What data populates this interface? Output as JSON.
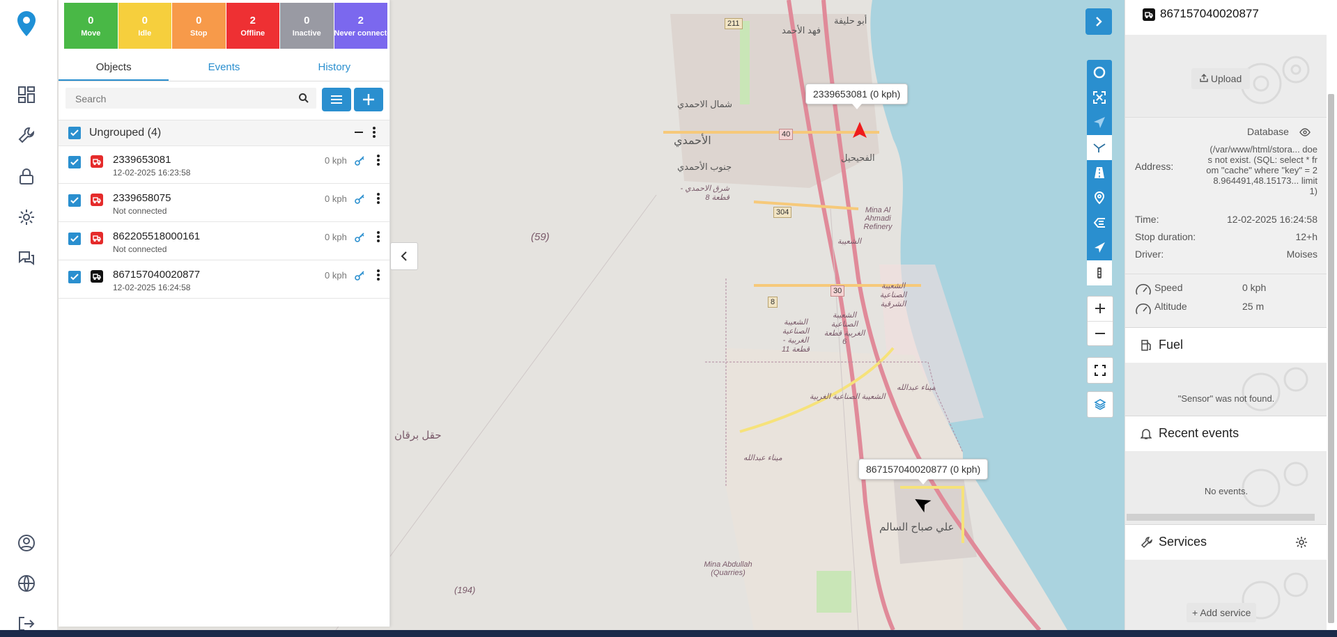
{
  "status_tiles": [
    {
      "count": "0",
      "label": "Move",
      "color": "#49b846"
    },
    {
      "count": "0",
      "label": "Idle",
      "color": "#f6cf3d"
    },
    {
      "count": "0",
      "label": "Stop",
      "color": "#f79a4a"
    },
    {
      "count": "2",
      "label": "Offline",
      "color": "#ee3033"
    },
    {
      "count": "0",
      "label": "Inactive",
      "color": "#999aa3"
    },
    {
      "count": "2",
      "label": "Never connected",
      "color": "#7b68ee"
    }
  ],
  "tabs": [
    "Objects",
    "Events",
    "History"
  ],
  "search": {
    "placeholder": "Search"
  },
  "group": {
    "label": "Ungrouped (4)"
  },
  "objects": [
    {
      "name": "2339653081",
      "sub": "12-02-2025 16:23:58",
      "speed": "0 kph",
      "icon_color": "#e52b2b"
    },
    {
      "name": "2339658075",
      "sub": "Not connected",
      "speed": "0 kph",
      "icon_color": "#e52b2b"
    },
    {
      "name": "862205518000161",
      "sub": "Not connected",
      "speed": "0 kph",
      "icon_color": "#e52b2b"
    },
    {
      "name": "867157040020877",
      "sub": "12-02-2025 16:24:58",
      "speed": "0 kph",
      "icon_color": "#111111"
    }
  ],
  "map": {
    "labels": {
      "abu_halifa": "أبو حليفة",
      "fahad_ahmad": "فهد الأحمد",
      "shamal_ahmadi": "شمال الاحمدي",
      "ahmadi": "الأحمدي",
      "janub_ahmadi": "جنوب الأحمدي",
      "sharq_ahmadi": "شرق الاحمدي - قطعة 8",
      "fahaheel": "الفحيحيل",
      "mina_refinery": "Mina Al Ahmadi Refinery",
      "shuaiba": "الشعيبة",
      "shuaiba_east": "الشعيبة الصناعية الشرقية",
      "shuaiba_west6": "الشعيبة الصناعية الغربية قطعة 6",
      "shuaiba_west11": "الشعيبة الصناعية الغربية - قطعة 11",
      "shuaiba_west": "الشعيبة الصناعية الغربية",
      "mina_abdullah_ar": "ميناء عبدالله",
      "mina_abdullah_ar2": "ميناء عبدالله",
      "burgan": "حقل برقان",
      "ali_sabah": "علي صباح السالم",
      "quarries": "Mina Abdullah (Quarries)",
      "r59": "(59)",
      "r194": "(194)"
    },
    "shields": [
      "211",
      "40",
      "304",
      "30",
      "8"
    ],
    "tooltips": [
      "2339653081 (0 kph)",
      "867157040020877 (0 kph)"
    ]
  },
  "info": {
    "title": "867157040020877",
    "upload_label": "Upload",
    "database_label": "Database",
    "address_label": "Address:",
    "address_value": "(/var/www/html/stora... does not exist. (SQL: select * from \"cache\" where \"key\" = 28.964491,48.15173... limit 1)",
    "time_label": "Time:",
    "time_value": "12-02-2025 16:24:58",
    "stop_label": "Stop duration:",
    "stop_value": "12+h",
    "driver_label": "Driver:",
    "driver_value": "Moises",
    "speed_label": "Speed",
    "speed_value": "0 kph",
    "altitude_label": "Altitude",
    "altitude_value": "25 m",
    "fuel_title": "Fuel",
    "fuel_msg": "\"Sensor\" was not found.",
    "events_title": "Recent events",
    "events_msg": "No events.",
    "services_title": "Services",
    "add_service_label": "Add service"
  }
}
